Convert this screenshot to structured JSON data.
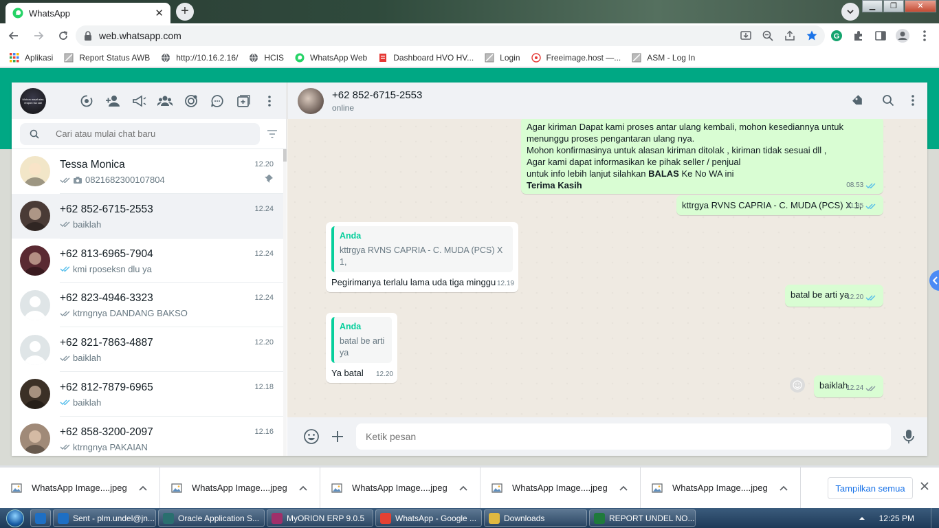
{
  "browser": {
    "tab_title": "WhatsApp",
    "url": "web.whatsapp.com"
  },
  "bookmarks": [
    {
      "label": "Aplikasi",
      "icon": "apps-grid-icon"
    },
    {
      "label": "Report Status AWB",
      "icon": "page-icon"
    },
    {
      "label": "http://10.16.2.16/",
      "icon": "globe-icon"
    },
    {
      "label": "HCIS",
      "icon": "globe-icon"
    },
    {
      "label": "WhatsApp Web",
      "icon": "whatsapp-icon"
    },
    {
      "label": "Dashboard HVO HV...",
      "icon": "document-icon"
    },
    {
      "label": "Login",
      "icon": "page-icon"
    },
    {
      "label": "Freeimage.host —...",
      "icon": "freeimage-icon"
    },
    {
      "label": "ASM - Log In",
      "icon": "page-icon"
    }
  ],
  "sidebar": {
    "my_avatar_text": "Mohon maaf atas respon via call",
    "search_placeholder": "Cari atau mulai chat baru",
    "chats": [
      {
        "name": "Tessa Monica",
        "time": "12.20",
        "preview": "0821682300107804",
        "read": false,
        "photo": true,
        "pinned": true,
        "avatar_color": "#f2e6c8"
      },
      {
        "name": "+62 852-6715-2553",
        "time": "12.24",
        "preview": "baiklah",
        "read": false,
        "active": true,
        "avatar_color": "#4a3b36"
      },
      {
        "name": "+62 813-6965-7904",
        "time": "12.24",
        "preview": "kmi rposeksn dlu ya",
        "read": true,
        "avatar_color": "#5a2a32"
      },
      {
        "name": "+62 823-4946-3323",
        "time": "12.24",
        "preview": "ktrngnya DANDANG BAKSO",
        "read": false,
        "avatar_color": "#dfe5e7"
      },
      {
        "name": "+62 821-7863-4887",
        "time": "12.20",
        "preview": "baiklah",
        "read": false,
        "avatar_color": "#dfe5e7"
      },
      {
        "name": "+62 812-7879-6965",
        "time": "12.18",
        "preview": "baiklah",
        "read": true,
        "avatar_color": "#3b3026"
      },
      {
        "name": "+62 858-3200-2097",
        "time": "12.16",
        "preview": "ktrngnya PAKAIAN",
        "read": false,
        "avatar_color": "#a08a78"
      }
    ]
  },
  "conversation": {
    "name": "+62 852-6715-2553",
    "status": "online",
    "composer_placeholder": "Ketik pesan",
    "msg1": {
      "line1": "Agar kiriman Dapat kami proses antar ulang kembali, mohon kesediannya untuk",
      "line2": "menunggu proses pengantaran ulang nya.",
      "line3": "Mohon konfirmasinya untuk alasan kiriman ditolak , kiriman tidak sesuai dll ,",
      "line4": "Agar kami dapat informasikan ke pihak seller / penjual",
      "line5_pre": "untuk info lebih lanjut silahkan ",
      "line5_bold": "BALAS",
      "line5_post": " Ke No WA ini",
      "line6_bold": "Terima Kasih",
      "time": "08.53"
    },
    "msg2": {
      "text": "kttrgya RVNS CAPRIA - C. MUDA (PCS) X 1,",
      "time": "11.35"
    },
    "msg3": {
      "quote_author": "Anda",
      "quote_text": "kttrgya RVNS CAPRIA - C. MUDA (PCS) X 1,",
      "text": "Pegirimanya terlalu lama uda tiga minggu",
      "time": "12.19"
    },
    "msg4": {
      "text": "batal be arti ya",
      "time": "12.20"
    },
    "msg5": {
      "quote_author": "Anda",
      "quote_text": "batal be arti ya",
      "text": "Ya batal",
      "time": "12.20"
    },
    "msg6": {
      "text": "baiklah",
      "time": "12.24"
    }
  },
  "downloads": {
    "items": [
      "WhatsApp Image....jpeg",
      "WhatsApp Image....jpeg",
      "WhatsApp Image....jpeg",
      "WhatsApp Image....jpeg",
      "WhatsApp Image....jpeg"
    ],
    "show_all": "Tampilkan semua"
  },
  "taskbar": {
    "items": [
      {
        "label": "Sent - plm.undel@jn...",
        "color": "#1e6fc4",
        "width": 150
      },
      {
        "label": "Oracle Application S...",
        "color": "#2a6f6f",
        "width": 155
      },
      {
        "label": "MyORION ERP 9.0.5",
        "color": "#a0306a",
        "width": 155
      },
      {
        "label": "WhatsApp - Google ...",
        "color": "#e34133",
        "width": 155
      },
      {
        "label": "Downloads",
        "color": "#e0b840",
        "width": 150
      },
      {
        "label": "REPORT UNDEL NO...",
        "color": "#1f7a3c",
        "width": 155
      }
    ],
    "time": "12:25 PM"
  },
  "colors": {
    "accent": "#00a884",
    "outgoing": "#d9fdd3",
    "read_tick": "#53bdeb"
  }
}
